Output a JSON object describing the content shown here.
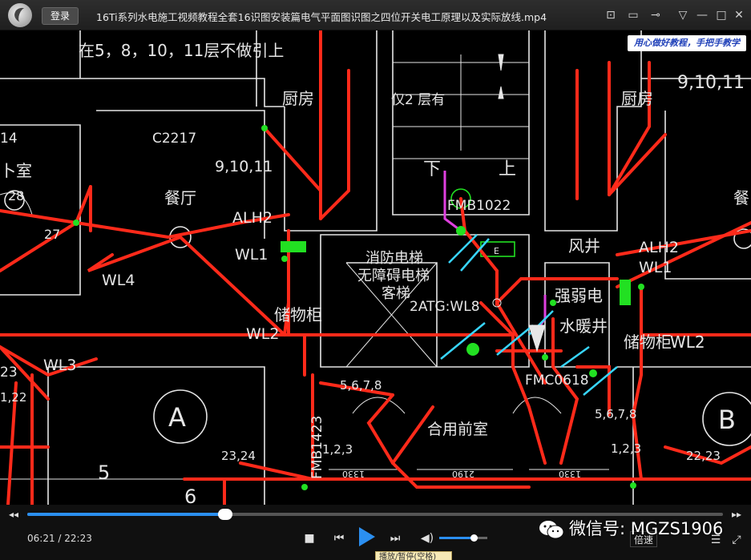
{
  "titlebar": {
    "login_label": "登录",
    "title": "16Ti系列水电施工视频教程全套16识图安装篇电气平面图识图之四位开关电工原理以及实际放线.mp4",
    "icons": [
      "screenshot-icon",
      "folder-icon",
      "pin-icon",
      "menu-icon",
      "minimize-icon",
      "maximize-icon",
      "close-icon"
    ]
  },
  "video": {
    "watermark": "用心做好教程，手把手教学",
    "cad_labels": {
      "top_note": "在5，8，10，11层不做引上",
      "kitchen_left": "厨房",
      "kitchen_right": "厨房",
      "only_2f": "仅2 层有",
      "nine_ten_eleven_right": "9,10,11",
      "c2217": "C2217",
      "nine_ten_eleven_mid": "9,10,11",
      "dining": "餐厅",
      "dining_right": "餐",
      "bedroom_left": "卜室",
      "down": "下",
      "up": "上",
      "fmb1022": "FMB1022",
      "alh2_left": "ALH2",
      "alh2_right": "ALH2",
      "wl1_left": "WL1",
      "wl1_right": "WL1",
      "wl4": "WL4",
      "wl2_left": "WL2",
      "wl2_right": "WL2",
      "wl3": "WL3",
      "fire_elevator": "消防电梯",
      "barrier_free": "无障碍电梯",
      "passenger": "客梯",
      "atg": "2ATG:WL8",
      "storage_left": "储物柜",
      "storage_right": "储物柜",
      "wind_shaft": "风井",
      "strong_weak": "强弱电",
      "water_heat": "水暖井",
      "fmc": "FMC0618",
      "common_front": "合用前室",
      "a_circle": "A",
      "b_circle": "B",
      "e_box": "E",
      "five_six_seven_eight_left": "5,6,7,8",
      "five_six_seven_eight_right": "5,6,7,8",
      "one_two_three_left": "1,2,3",
      "one_two_three_right": "1,2,3",
      "twenty_three_twenty_four": "23,24",
      "twenty_two_twenty_three": "22,23",
      "dim_1330_left": "1330",
      "dim_2190": "2190",
      "dim_1330_right": "1330",
      "one_twenty_two": "1,22",
      "n14": "14",
      "n28": "28",
      "n27": "27",
      "n5a": "5",
      "n6a": "6",
      "n23": "23",
      "fmb1423": "FMB1423"
    }
  },
  "controls": {
    "time": "06:21 / 22:23",
    "progress": 0.284,
    "volume": 0.72,
    "speed_label": "倍速",
    "wechat_text": "微信号: MGZS1906",
    "tooltip": "播放/暂停(空格)"
  },
  "colors": {
    "accent": "#2b8ff0",
    "cad_red": "#ff2a1a",
    "cad_white": "#e6e6e6",
    "cad_green": "#22e022",
    "cad_cyan": "#38d6ff",
    "cad_magenta": "#e040e0"
  }
}
